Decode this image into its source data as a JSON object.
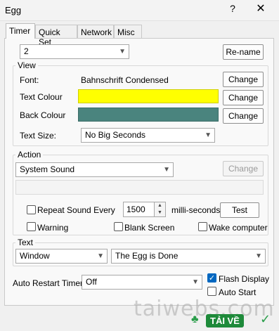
{
  "window": {
    "title": "Egg",
    "help_glyph": "?",
    "close_glyph": "✕"
  },
  "tabs": [
    "Timer",
    "Quick Set",
    "Network",
    "Misc"
  ],
  "timer_select": {
    "value": "2"
  },
  "rename_label": "Re-name",
  "view": {
    "legend": "View",
    "font_label": "Font:",
    "font_value": "Bahnschrift Condensed",
    "text_colour_label": "Text Colour",
    "back_colour_label": "Back Colour",
    "text_size_label": "Text Size:",
    "text_size_value": "No Big Seconds",
    "change_label": "Change",
    "text_colour_hex": "#ffff00",
    "back_colour_hex": "#4a847e"
  },
  "action": {
    "legend": "Action",
    "type_value": "System Sound",
    "change_label": "Change",
    "repeat_label": "Repeat Sound Every",
    "repeat_value": "1500",
    "repeat_unit": "milli-seconds.",
    "test_label": "Test",
    "warning_label": "Warning",
    "blank_screen_label": "Blank Screen",
    "wake_label": "Wake computer"
  },
  "text_group": {
    "legend": "Text",
    "mode_value": "Window",
    "message_value": "The Egg is Done"
  },
  "auto_restart": {
    "label": "Auto Restart Timer",
    "value": "Off"
  },
  "flash_display_label": "Flash Display",
  "auto_start_label": "Auto Start",
  "watermark": {
    "text": "taiwebs.com",
    "logo": "TẢI VỀ"
  }
}
